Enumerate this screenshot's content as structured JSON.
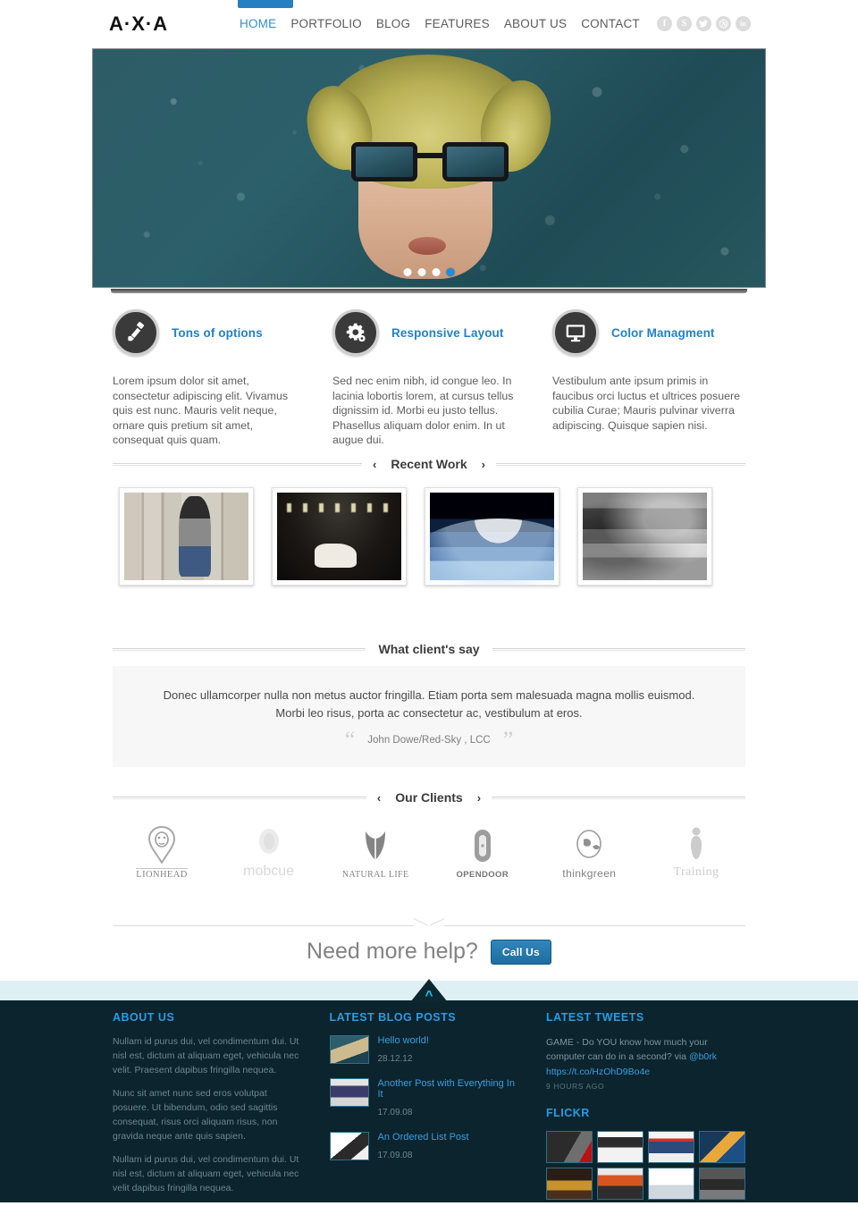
{
  "header": {
    "logo": "A·X·A",
    "nav": [
      {
        "label": "HOME",
        "active": true
      },
      {
        "label": "PORTFOLIO",
        "active": false
      },
      {
        "label": "BLOG",
        "active": false
      },
      {
        "label": "FEATURES",
        "active": false
      },
      {
        "label": "ABOUT US",
        "active": false
      },
      {
        "label": "CONTACT",
        "active": false
      }
    ],
    "social": [
      {
        "name": "facebook-icon",
        "glyph": "f"
      },
      {
        "name": "skype-icon",
        "glyph": "S"
      },
      {
        "name": "twitter-icon",
        "glyph": "t"
      },
      {
        "name": "dribbble-icon",
        "glyph": "●"
      },
      {
        "name": "linkedin-icon",
        "glyph": "in"
      }
    ],
    "accent_color": "#2580c3"
  },
  "hero": {
    "slides_total": 4,
    "active_slide": 4,
    "image_alt": "woman-with-sunglasses-in-rain"
  },
  "features": [
    {
      "icon": "brush-icon",
      "title": "Tons of options",
      "text": "Lorem ipsum dolor sit amet, consectetur adipiscing elit. Vivamus quis est nunc. Mauris velit neque, ornare quis pretium sit amet, consequat quis quam."
    },
    {
      "icon": "gears-icon",
      "title": "Responsive Layout",
      "text": "Sed nec enim nibh, id congue leo. In lacinia lobortis lorem, at cursus tellus dignissim id. Morbi eu justo tellus. Phasellus aliquam dolor enim. In ut augue dui."
    },
    {
      "icon": "monitor-icon",
      "title": "Color Managment",
      "text": "Vestibulum ante ipsum primis in faucibus orci luctus et ultrices posuere cubilia Curae; Mauris pulvinar viverra adipiscing. Quisque sapien nisi."
    }
  ],
  "recent_work": {
    "title": "Recent Work",
    "prev_arrow": "‹",
    "next_arrow": "›",
    "items": [
      {
        "alt": "woman-with-mohawk-at-lockers"
      },
      {
        "alt": "white-horse-on-theatre-stage"
      },
      {
        "alt": "earth-from-space"
      },
      {
        "alt": "black-and-white-clouds"
      }
    ]
  },
  "testimonial": {
    "title": "What client's say",
    "quote": "Donec ullamcorper nulla non metus auctor fringilla. Etiam porta sem malesuada magna mollis euismod. Morbi leo risus, porta ac consectetur ac, vestibulum at eros.",
    "author": "John Dowe/Red-Sky , LCC",
    "quote_open": "“",
    "quote_close": "”"
  },
  "clients": {
    "title": "Our Clients",
    "prev_arrow": "‹",
    "next_arrow": "›",
    "logos": [
      {
        "name": "LIONHEAD",
        "mark": "lion-shield-icon"
      },
      {
        "name": "mobcue",
        "mark": "sheep-icon"
      },
      {
        "name": "NATURAL LIFE",
        "mark": "tulip-icon"
      },
      {
        "name": "OPENDOOR",
        "mark": "door-icon"
      },
      {
        "name": "thinkgreen",
        "mark": "leaf-head-icon"
      },
      {
        "name": "Training",
        "mark": "person-icon"
      }
    ]
  },
  "cta": {
    "text": "Need more help?",
    "button": "Call Us"
  },
  "footer": {
    "back_to_top": "▲",
    "about": {
      "heading": "ABOUT US",
      "paragraphs": [
        "Nullam id purus dui, vel condimentum dui. Ut nisl est, dictum at aliquam eget, vehicula nec velit. Praesent dapibus fringilla nequea.",
        "Nunc sit amet nunc sed eros volutpat posuere. Ut bibendum, odio sed sagittis consequat, risus orci aliquam risus, non gravida neque ante quis sapien.",
        "Nullam id purus dui, vel condimentum dui. Ut nisl est, dictum at aliquam eget, vehicula nec velit dapibus fringilla nequea."
      ]
    },
    "blog": {
      "heading": "LATEST BLOG POSTS",
      "posts": [
        {
          "title": "Hello world!",
          "date": "28.12.12"
        },
        {
          "title": "Another Post with Everything In It",
          "date": "17.09.08"
        },
        {
          "title": "An Ordered List Post",
          "date": "17.09.08"
        }
      ]
    },
    "tweets": {
      "heading": "LATEST TWEETS",
      "text_before": "GAME - Do YOU know how much your computer can do in a second? via ",
      "handle": "@b0rk",
      "link": " https://t.co/HzOhD9Bo4e",
      "time": "9 HOURS AGO"
    },
    "flickr": {
      "heading": "FLICKR",
      "thumbs": [
        {
          "alt": "flickr-thumb-1"
        },
        {
          "alt": "flickr-thumb-2"
        },
        {
          "alt": "flickr-thumb-3"
        },
        {
          "alt": "flickr-thumb-4"
        },
        {
          "alt": "flickr-thumb-5"
        },
        {
          "alt": "flickr-thumb-6"
        },
        {
          "alt": "flickr-thumb-7"
        },
        {
          "alt": "flickr-thumb-8"
        }
      ]
    },
    "background_color": "#0b242e",
    "heading_color": "#2e9bdd"
  }
}
